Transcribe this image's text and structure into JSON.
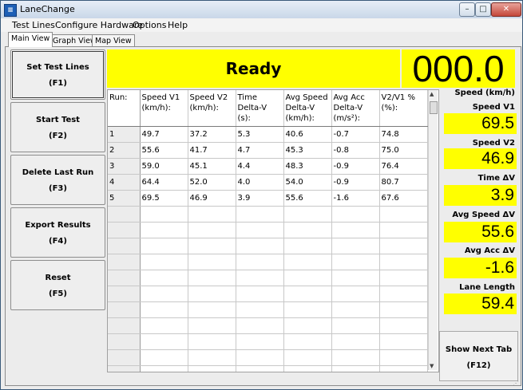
{
  "window": {
    "title": "LaneChange"
  },
  "menu": [
    "Test Lines",
    "Configure Hardware",
    "Options",
    "Help"
  ],
  "tabs": [
    "Main View",
    "Graph View",
    "Map View"
  ],
  "buttons": [
    {
      "label": "Set Test Lines",
      "key": "(F1)"
    },
    {
      "label": "Start Test",
      "key": "(F2)"
    },
    {
      "label": "Delete Last Run",
      "key": "(F3)"
    },
    {
      "label": "Export Results",
      "key": "(F4)"
    },
    {
      "label": "Reset",
      "key": "(F5)"
    }
  ],
  "status": {
    "text": "Ready",
    "speed_display": "000.0"
  },
  "table": {
    "headers": [
      "Run:",
      "Speed V1 (km/h):",
      "Speed V2 (km/h):",
      "Time Delta-V (s):",
      "Avg Speed Delta-V (km/h):",
      "Avg Acc Delta-V (m/s²):",
      "V2/V1 % (%):"
    ],
    "rows": [
      [
        "1",
        "49.7",
        "37.2",
        "5.3",
        "40.6",
        "-0.7",
        "74.8"
      ],
      [
        "2",
        "55.6",
        "41.7",
        "4.7",
        "45.3",
        "-0.8",
        "75.0"
      ],
      [
        "3",
        "59.0",
        "45.1",
        "4.4",
        "48.3",
        "-0.9",
        "76.4"
      ],
      [
        "4",
        "64.4",
        "52.0",
        "4.0",
        "54.0",
        "-0.9",
        "80.7"
      ],
      [
        "5",
        "69.5",
        "46.9",
        "3.9",
        "55.6",
        "-1.6",
        "67.6"
      ]
    ],
    "empty_row_count": 11
  },
  "stats": [
    {
      "label": "Speed (km/h)",
      "value": ""
    },
    {
      "label": "Speed V1",
      "value": "69.5"
    },
    {
      "label": "Speed V2",
      "value": "46.9"
    },
    {
      "label": "Time ΔV",
      "value": "3.9"
    },
    {
      "label": "Avg Speed ΔV",
      "value": "55.6"
    },
    {
      "label": "Avg Acc ΔV",
      "value": "-1.6"
    },
    {
      "label": "Lane Length",
      "value": "59.4"
    }
  ],
  "next_tab": {
    "label": "Show Next Tab",
    "key": "(F12)"
  },
  "colors": {
    "highlight": "#ffff00"
  }
}
